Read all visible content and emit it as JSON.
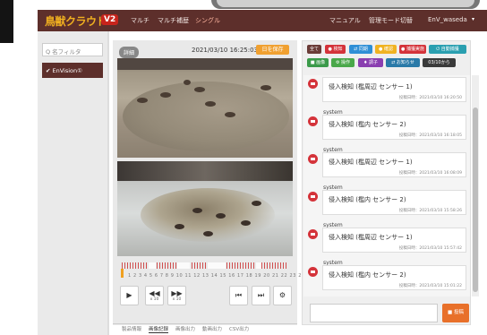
{
  "app": {
    "logo": "鳥獣クラウド",
    "version": "V2",
    "nav": [
      "マルチ",
      "マルチ補歴",
      "シングル"
    ],
    "right_nav": [
      "マニュアル",
      "管理モード切替"
    ],
    "user": "EnV_waseda"
  },
  "sidebar": {
    "filter_placeholder": "Q 名フィルタ",
    "env_label": "✔ EnVision①"
  },
  "viewer": {
    "badge": "詳細",
    "datetime": "2021/03/10 16:25:03",
    "save_label": "日を保存",
    "timeline_numbers": "1 2 3 4 5 6 7 8 9 10 11 12 13 14 15 16 17 18 19 20 21 22 23 24",
    "controls": [
      {
        "icon": "play-icon",
        "label": "▶"
      },
      {
        "icon": "rewind-icon",
        "label": "◀◀",
        "sub": "x 10"
      },
      {
        "icon": "fast-forward-icon",
        "label": "▶▶",
        "sub": "x 10"
      },
      {
        "icon": "skip-back-icon",
        "label": "⏮"
      },
      {
        "icon": "skip-forward-icon",
        "label": "⏭"
      },
      {
        "icon": "gear-icon",
        "label": "⚙"
      }
    ],
    "tabs": [
      "製品情報",
      "画像記録",
      "画像出力",
      "動画出力",
      "CSV出力"
    ]
  },
  "filters": [
    {
      "label": "全て",
      "color": "#6a3b37"
    },
    {
      "label": "● 検知",
      "color": "#d4333a"
    },
    {
      "label": "⇄ 同期",
      "color": "#2f8fd6"
    },
    {
      "label": "● 確認",
      "color": "#f0b322"
    },
    {
      "label": "● 捕獲実施",
      "color": "#d4333a"
    },
    {
      "label": "⏻ 自動捕獲",
      "color": "#2a9fb0"
    },
    {
      "label": "■ 画像",
      "color": "#3b9a4a"
    },
    {
      "label": "⚙ 操作",
      "color": "#4aa84a"
    },
    {
      "label": "♦ 調子",
      "color": "#8a3fb0"
    },
    {
      "label": "⇄ お知らせ",
      "color": "#2a7aa8"
    },
    {
      "label": "03/10から",
      "color": "#3a3a3a"
    }
  ],
  "messages": [
    {
      "sender": "",
      "text": "侵入検知 (檻周辺 センサー 1)",
      "time": "投稿日時：2021/03/10 16:20:50"
    },
    {
      "sender": "system",
      "text": "侵入検知 (檻内 センサー 2)",
      "time": "投稿日時：2021/03/10 16:18:05"
    },
    {
      "sender": "system",
      "text": "侵入検知 (檻周辺 センサー 1)",
      "time": "投稿日時：2021/03/10 16:08:09"
    },
    {
      "sender": "system",
      "text": "侵入検知 (檻内 センサー 2)",
      "time": "投稿日時：2021/03/10 15:58:26"
    },
    {
      "sender": "system",
      "text": "侵入検知 (檻周辺 センサー 1)",
      "time": "投稿日時：2021/03/10 15:57:42"
    },
    {
      "sender": "system",
      "text": "侵入検知 (檻内 センサー 2)",
      "time": "投稿日時：2021/03/10 15:01:22"
    }
  ],
  "compose": {
    "placeholder": "",
    "send_label": "■ 投稿"
  }
}
